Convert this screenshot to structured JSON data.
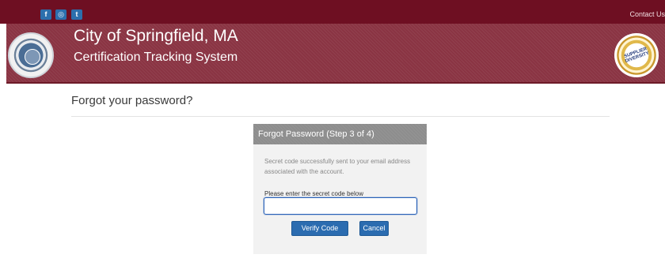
{
  "topbar": {
    "social": [
      "f",
      "◎",
      "t"
    ],
    "contact_label": "Contact Us"
  },
  "header": {
    "title": "City of Springfield, MA",
    "subtitle": "Certification Tracking System",
    "badge_text": "SUPPLIER DIVERSITY"
  },
  "page": {
    "heading": "Forgot your password?"
  },
  "card": {
    "title": "Forgot Password (Step 3 of 4)",
    "info": "Secret code successfully sent to your email address associated with the account.",
    "field_label": "Please enter the secret code below",
    "code_value": "",
    "verify_label": "Verify Code",
    "cancel_label": "Cancel"
  },
  "colors": {
    "topbar": "#6e0f22",
    "header": "#8a3443",
    "button": "#2b6cb0",
    "card_header": "#8d8d8d"
  }
}
